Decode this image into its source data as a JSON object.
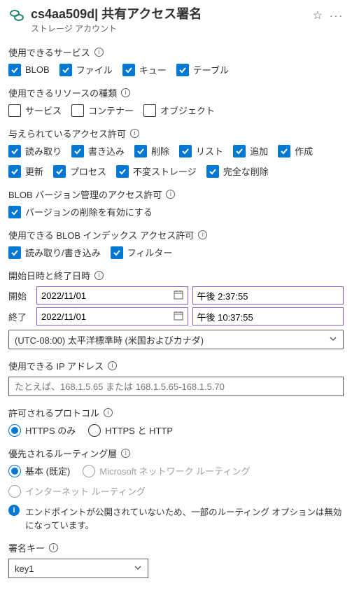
{
  "header": {
    "title": "cs4aa509d| 共有アクセス署名",
    "subtitle": "ストレージ アカウント"
  },
  "sections": {
    "services": {
      "label": "使用できるサービス",
      "items": [
        {
          "label": "BLOB",
          "checked": true
        },
        {
          "label": "ファイル",
          "checked": true
        },
        {
          "label": "キュー",
          "checked": true
        },
        {
          "label": "テーブル",
          "checked": true
        }
      ]
    },
    "resource_types": {
      "label": "使用できるリソースの種類",
      "items": [
        {
          "label": "サービス",
          "checked": false
        },
        {
          "label": "コンテナー",
          "checked": false
        },
        {
          "label": "オブジェクト",
          "checked": false
        }
      ]
    },
    "permissions": {
      "label": "与えられているアクセス許可",
      "items": [
        {
          "label": "読み取り",
          "checked": true
        },
        {
          "label": "書き込み",
          "checked": true
        },
        {
          "label": "削除",
          "checked": true
        },
        {
          "label": "リスト",
          "checked": true
        },
        {
          "label": "追加",
          "checked": true
        },
        {
          "label": "作成",
          "checked": true
        },
        {
          "label": "更新",
          "checked": true
        },
        {
          "label": "プロセス",
          "checked": true
        },
        {
          "label": "不変ストレージ",
          "checked": true
        },
        {
          "label": "完全な削除",
          "checked": true
        }
      ]
    },
    "blob_version": {
      "label": "BLOB バージョン管理のアクセス許可",
      "items": [
        {
          "label": "バージョンの削除を有効にする",
          "checked": true
        }
      ]
    },
    "blob_index": {
      "label": "使用できる BLOB インデックス アクセス許可",
      "items": [
        {
          "label": "読み取り/書き込み",
          "checked": true
        },
        {
          "label": "フィルター",
          "checked": true
        }
      ]
    },
    "datetime": {
      "label": "開始日時と終了日時",
      "start_label": "開始",
      "end_label": "終了",
      "start_date": "2022/11/01",
      "start_time": "午後 2:37:55",
      "end_date": "2022/11/01",
      "end_time": "午後 10:37:55",
      "timezone": "(UTC-08:00) 太平洋標準時 (米国およびカナダ)"
    },
    "ip": {
      "label": "使用できる IP アドレス",
      "placeholder": "たとえば、168.1.5.65 または 168.1.5.65-168.1.5.70"
    },
    "protocol": {
      "label": "許可されるプロトコル",
      "items": [
        {
          "label": "HTTPS のみ",
          "selected": true,
          "disabled": false
        },
        {
          "label": "HTTPS と HTTP",
          "selected": false,
          "disabled": false
        }
      ]
    },
    "routing": {
      "label": "優先されるルーティング層",
      "items": [
        {
          "label": "基本 (既定)",
          "selected": true,
          "disabled": false
        },
        {
          "label": "Microsoft ネットワーク ルーティング",
          "selected": false,
          "disabled": true
        },
        {
          "label": "インターネット ルーティング",
          "selected": false,
          "disabled": true
        }
      ],
      "info": "エンドポイントが公開されていないため、一部のルーティング オプションは無効になっています。"
    },
    "signing_key": {
      "label": "署名キー",
      "value": "key1"
    }
  }
}
